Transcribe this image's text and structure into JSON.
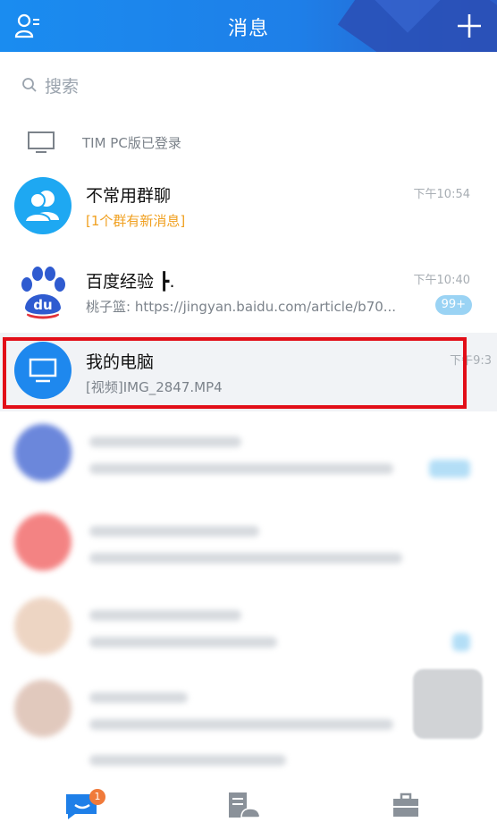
{
  "header": {
    "title": "消息"
  },
  "search": {
    "placeholder": "搜索"
  },
  "pc_login": {
    "text": "TIM PC版已登录"
  },
  "conversations": [
    {
      "name": "不常用群聊",
      "preview": "[1个群有新消息]",
      "time": "下午10:54"
    },
    {
      "name": "百度经验 ┣.",
      "preview": "桃子篮: https://jingyan.baidu.com/article/b70...",
      "time": "下午10:40",
      "badge": "99+"
    },
    {
      "name": "我的电脑",
      "preview": "[视频]IMG_2847.MP4",
      "time": "下午9:3"
    }
  ],
  "tabbar": {
    "messages_badge": "1"
  },
  "colors": {
    "header_blue": "#1e7fe8",
    "highlight_red": "#e20e18",
    "orange_notice": "#f0a020"
  }
}
